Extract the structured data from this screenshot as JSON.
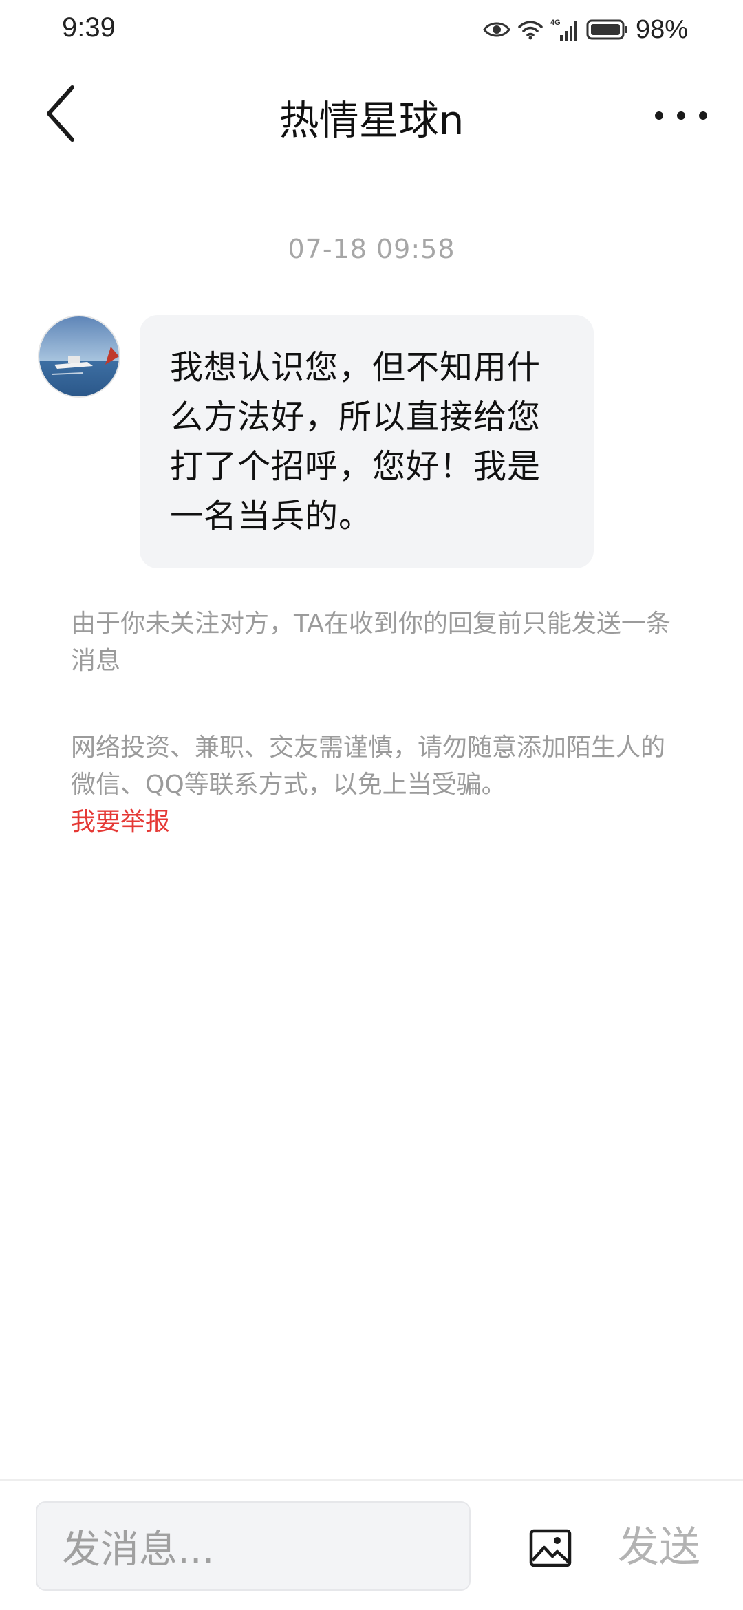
{
  "status_bar": {
    "time": "9:39",
    "battery_percent": "98%",
    "network_label": "4G",
    "icons": [
      "eye-icon",
      "wifi-icon",
      "signal-icon",
      "battery-icon"
    ]
  },
  "header": {
    "title": "热情星球n",
    "back_icon": "chevron-left-icon",
    "more_icon": "more-horizontal-icon"
  },
  "chat": {
    "timestamp": "07-18 09:58",
    "messages": [
      {
        "sender": "other",
        "avatar": "avatar-image",
        "text": "我想认识您，但不知用什么方法好，所以直接给您打了个招呼，您好！我是一名当兵的。"
      }
    ]
  },
  "notices": {
    "follow_notice": "由于你未关注对方，TA在收到你的回复前只能发送一条消息",
    "warning_notice": "网络投资、兼职、交友需谨慎，请勿随意添加陌生人的微信、QQ等联系方式，以免上当受骗。",
    "report_label": "我要举报"
  },
  "input_bar": {
    "placeholder": "发消息...",
    "image_icon": "image-icon",
    "send_label": "发送"
  },
  "colors": {
    "report_red": "#e53935",
    "bubble_bg": "#f3f4f6",
    "muted_text": "#9b9b9b"
  }
}
